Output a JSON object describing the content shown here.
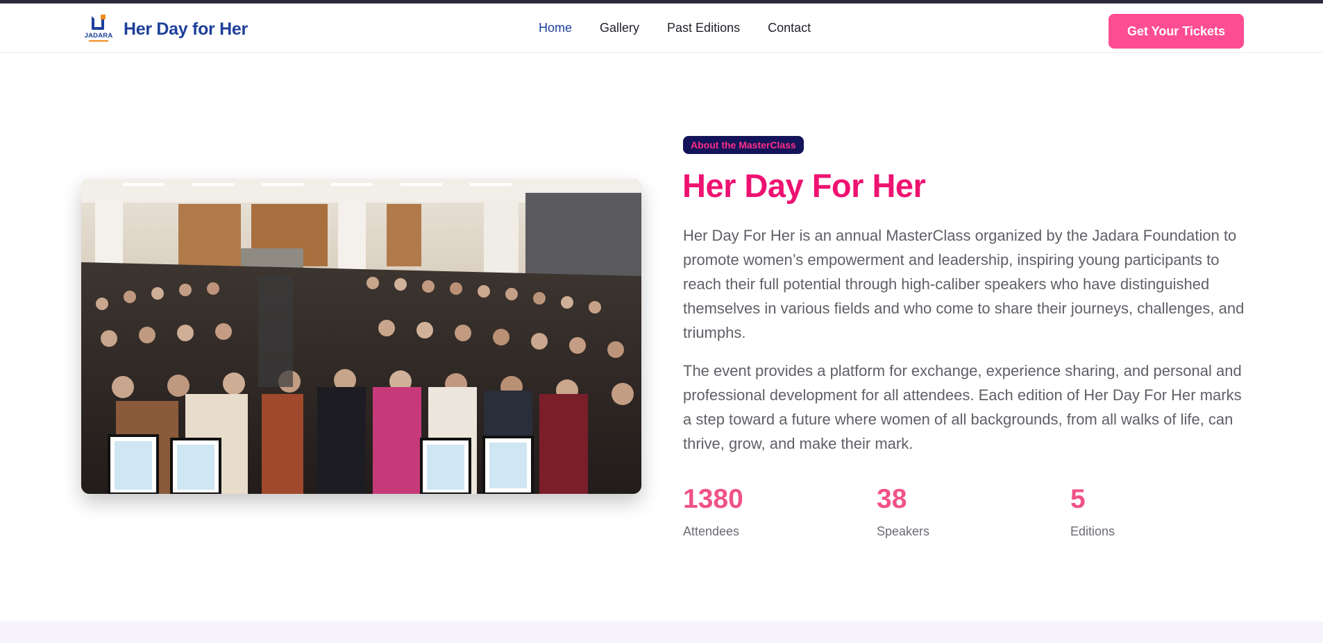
{
  "brand": {
    "logo_text": "JADARA",
    "name": "Her Day for Her"
  },
  "nav": {
    "items": [
      {
        "label": "Home",
        "active": true
      },
      {
        "label": "Gallery",
        "active": false
      },
      {
        "label": "Past Editions",
        "active": false
      },
      {
        "label": "Contact",
        "active": false
      }
    ],
    "cta_label": "Get Your Tickets"
  },
  "about": {
    "badge": "About the MasterClass",
    "title": "Her Day For Her",
    "paragraph1": "Her Day For Her is an annual MasterClass organized by the Jadara Foundation to promote women’s empowerment and leadership, inspiring young participants to reach their full potential through high-caliber speakers who have distinguished themselves in various fields and who come to share their journeys, challenges, and triumphs.",
    "paragraph2": "The event provides a platform for exchange, experience sharing, and personal and professional development for all attendees. Each edition of Her Day For Her marks a step toward a future where women of all backgrounds, from all walks of life, can thrive, grow, and make their mark.",
    "stats": [
      {
        "value": "1380",
        "label": "Attendees"
      },
      {
        "value": "38",
        "label": "Speakers"
      },
      {
        "value": "5",
        "label": "Editions"
      }
    ]
  },
  "colors": {
    "brand_blue": "#1d3f9a",
    "accent_pink": "#ff4d94",
    "title_pink": "#ee1271",
    "badge_bg": "#14145a"
  }
}
